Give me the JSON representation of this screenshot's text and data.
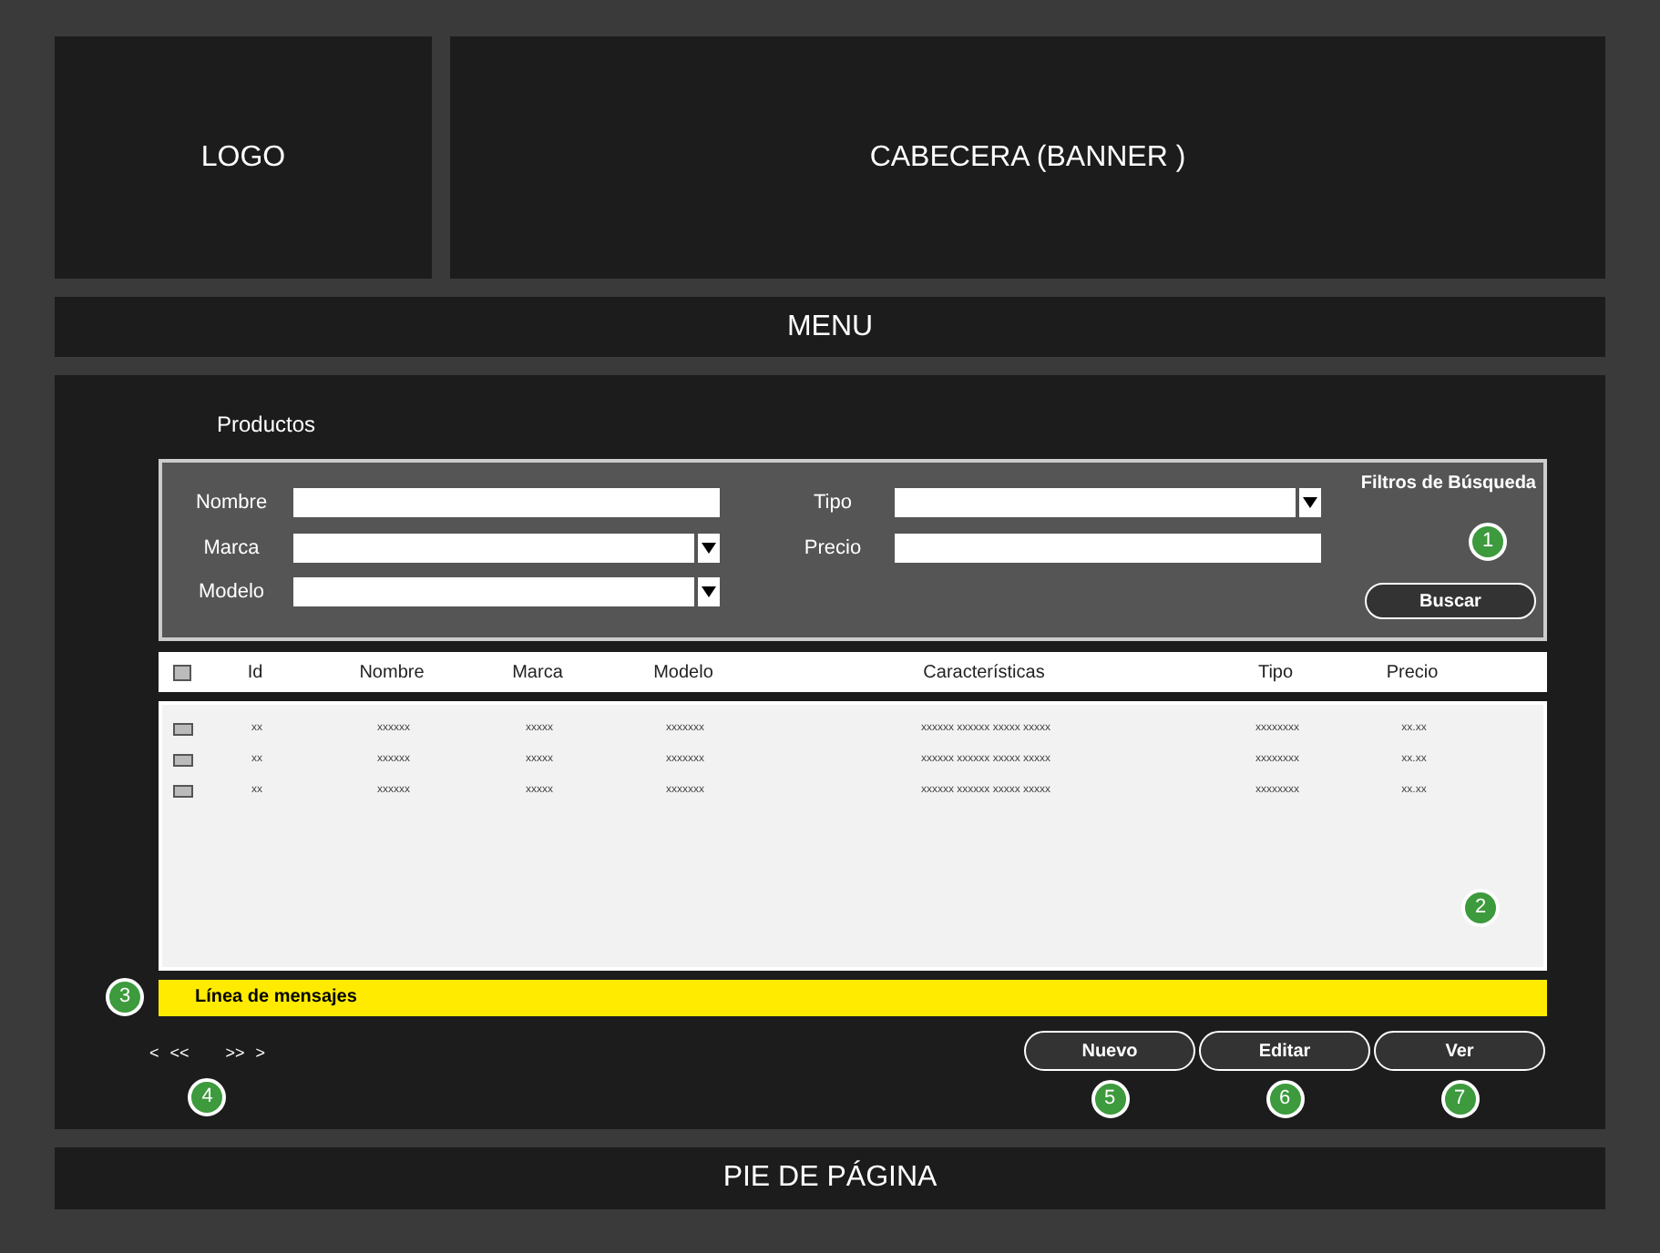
{
  "logo": "LOGO",
  "banner": "CABECERA (BANNER )",
  "menu": "MENU",
  "section_title": "Productos",
  "filters": {
    "title": "Filtros de Búsqueda",
    "badge": "1",
    "button": "Buscar",
    "left": [
      {
        "label": "Nombre",
        "kind": "text"
      },
      {
        "label": "Marca",
        "kind": "select"
      },
      {
        "label": "Modelo",
        "kind": "select"
      }
    ],
    "right": [
      {
        "label": "Tipo",
        "kind": "select"
      },
      {
        "label": "Precio",
        "kind": "text"
      }
    ]
  },
  "table": {
    "header_checked": false,
    "columns": [
      "Id",
      "Nombre",
      "Marca",
      "Modelo",
      "Características",
      "Tipo",
      "Precio"
    ],
    "rows": [
      {
        "checked": false,
        "cells": [
          "xx",
          "xxxxxx",
          "xxxxx",
          "xxxxxxx",
          "xxxxxx xxxxxx xxxxx xxxxx",
          "xxxxxxxx",
          "xx.xx"
        ]
      },
      {
        "checked": false,
        "cells": [
          "xx",
          "xxxxxx",
          "xxxxx",
          "xxxxxxx",
          "xxxxxx xxxxxx xxxxx xxxxx",
          "xxxxxxxx",
          "xx.xx"
        ]
      },
      {
        "checked": false,
        "cells": [
          "xx",
          "xxxxxx",
          "xxxxx",
          "xxxxxxx",
          "xxxxxx xxxxxx xxxxx xxxxx",
          "xxxxxxxx",
          "xx.xx"
        ]
      }
    ],
    "badge": "2"
  },
  "message": {
    "text": "Línea de mensajes",
    "badge": "3"
  },
  "pagination": {
    "links": [
      "<",
      "<<",
      ">>",
      ">"
    ],
    "badge": "4"
  },
  "actions": [
    {
      "label": "Nuevo",
      "badge": "5"
    },
    {
      "label": "Editar",
      "badge": "6"
    },
    {
      "label": "Ver",
      "badge": "7"
    }
  ],
  "footer": "PIE DE PÁGINA"
}
